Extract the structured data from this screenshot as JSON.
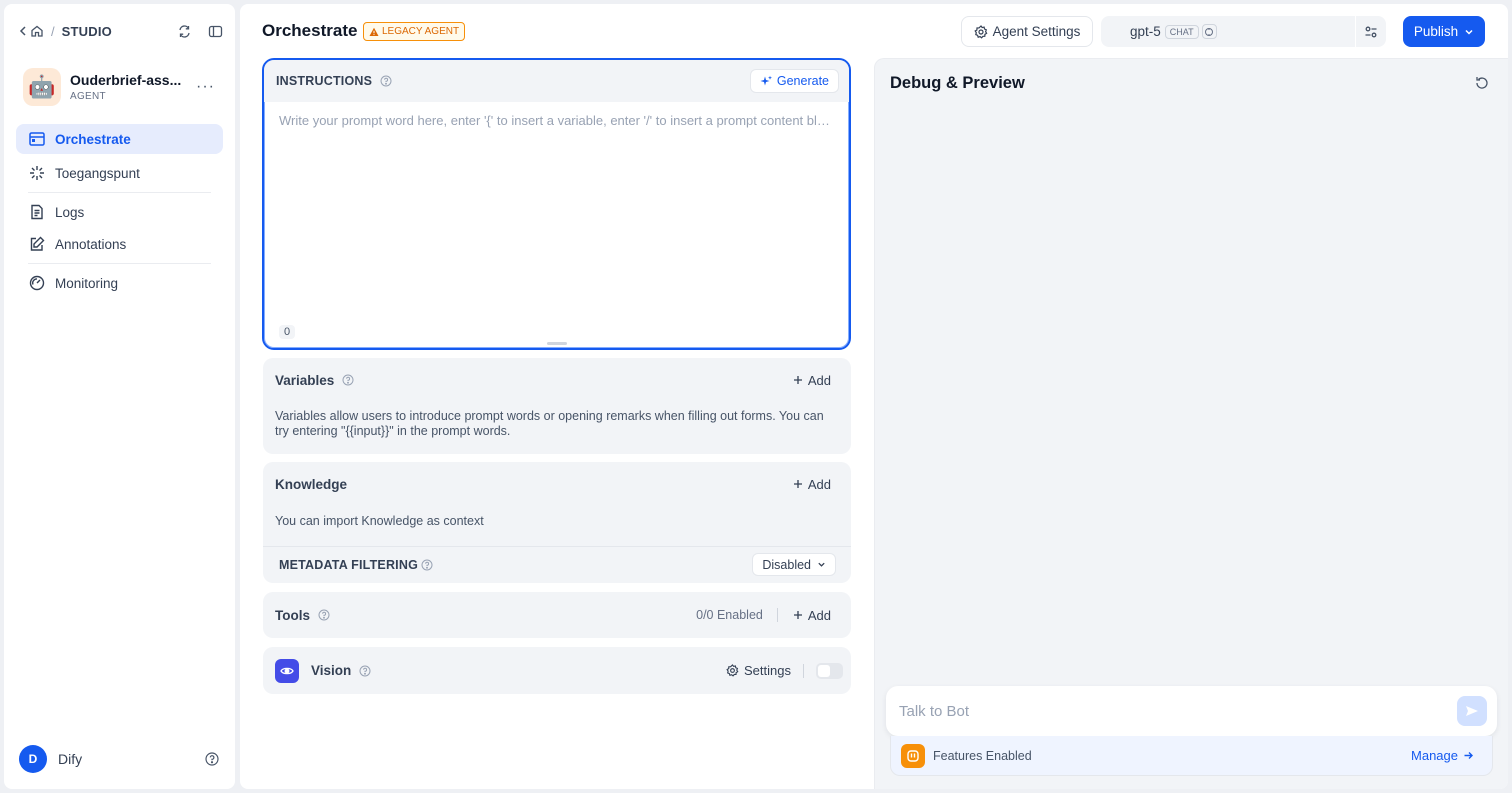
{
  "breadcrumb": {
    "section": "STUDIO"
  },
  "app": {
    "name": "Ouderbrief-ass...",
    "type": "AGENT"
  },
  "nav": {
    "items": [
      {
        "label": "Orchestrate"
      },
      {
        "label": "Toegangspunt"
      },
      {
        "label": "Logs"
      },
      {
        "label": "Annotations"
      },
      {
        "label": "Monitoring"
      }
    ]
  },
  "user": {
    "initial": "D",
    "name": "Dify"
  },
  "header": {
    "title": "Orchestrate",
    "legacy_badge": "LEGACY AGENT",
    "agent_settings_label": "Agent Settings",
    "model_name": "gpt-5",
    "model_mode": "CHAT",
    "publish_label": "Publish"
  },
  "instructions": {
    "title": "INSTRUCTIONS",
    "generate_label": "Generate",
    "placeholder": "Write your prompt word here, enter '{' to insert a variable, enter '/' to insert a prompt content block",
    "char_count": "0"
  },
  "variables": {
    "title": "Variables",
    "add_label": "Add",
    "description": "Variables allow users to introduce prompt words or opening remarks when filling out forms. You can try entering \"{{input}}\" in the prompt words."
  },
  "knowledge": {
    "title": "Knowledge",
    "add_label": "Add",
    "description": "You can import Knowledge as context",
    "metadata_title": "METADATA FILTERING",
    "metadata_value": "Disabled"
  },
  "tools": {
    "title": "Tools",
    "enabled_count": "0/0 Enabled",
    "add_label": "Add"
  },
  "vision": {
    "title": "Vision",
    "settings_label": "Settings",
    "enabled": false
  },
  "debug": {
    "title": "Debug & Preview",
    "input_placeholder": "Talk to Bot",
    "features_label": "Features Enabled",
    "manage_label": "Manage"
  },
  "colors": {
    "accent": "#155aef",
    "warning": "#dc6803",
    "vision": "#444ce7",
    "features": "#f79009"
  }
}
